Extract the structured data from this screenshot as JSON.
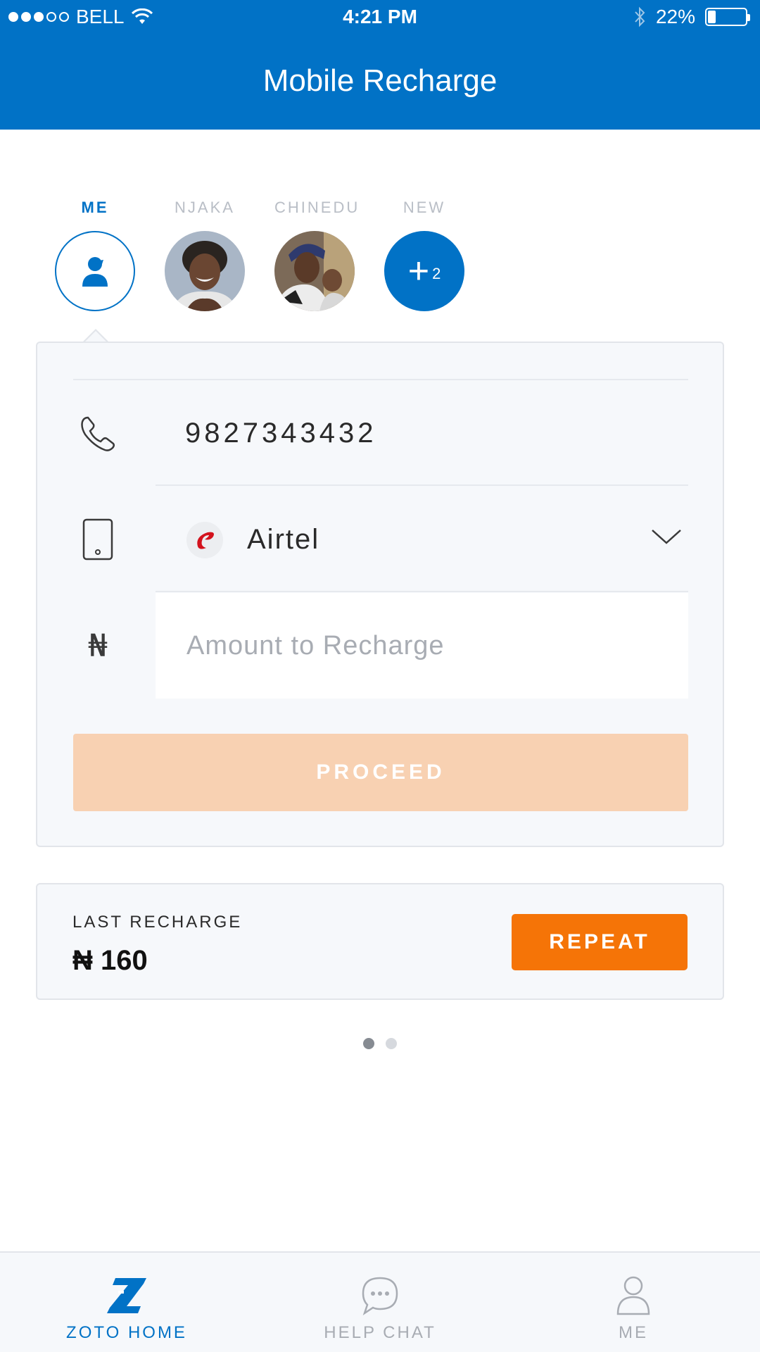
{
  "status_bar": {
    "carrier": "BELL",
    "time": "4:21 PM",
    "battery": "22%",
    "battery_level": 0.22
  },
  "header": {
    "title": "Mobile Recharge"
  },
  "contacts": [
    {
      "name": "ME",
      "active": true
    },
    {
      "name": "NJAKA",
      "active": false
    },
    {
      "name": "CHINEDU",
      "active": false
    },
    {
      "name": "NEW",
      "active": false,
      "plus": "+",
      "count": "2"
    }
  ],
  "recharge": {
    "phone_number": "9827343432",
    "operator": "Airtel",
    "amount_placeholder": "Amount to Recharge",
    "amount_value": "",
    "currency_symbol": "₦",
    "proceed_label": "PROCEED"
  },
  "last_recharge": {
    "label": "LAST RECHARGE",
    "amount": "₦ 160",
    "repeat_label": "REPEAT"
  },
  "pager": {
    "pages": 2,
    "current": 1
  },
  "tabs": [
    {
      "label": "ZOTO HOME",
      "active": true
    },
    {
      "label": "HELP CHAT",
      "active": false
    },
    {
      "label": "ME",
      "active": false
    }
  ],
  "colors": {
    "brand": "#0172c6",
    "accent": "#f57407",
    "disabled": "#f8d1b2"
  }
}
